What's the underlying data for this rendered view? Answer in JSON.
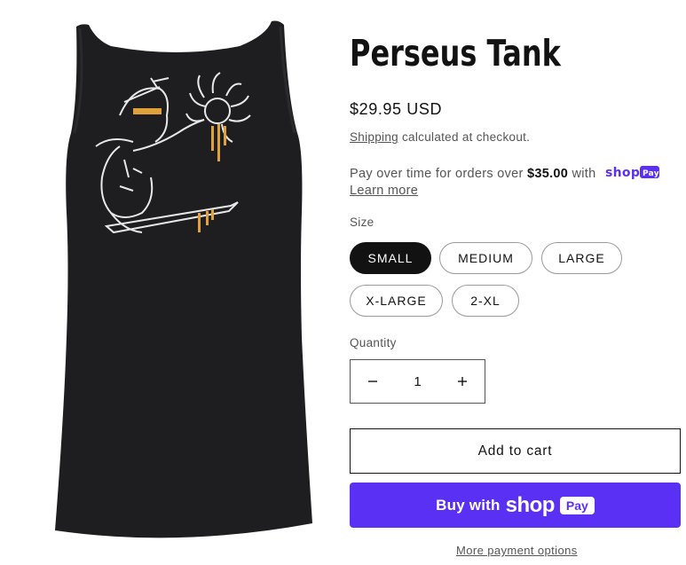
{
  "product": {
    "title": "Perseus Tank",
    "price": "$29.95 USD",
    "shipping_link": "Shipping",
    "shipping_text": " calculated at checkout.",
    "installments": {
      "prefix": "Pay over time for orders over ",
      "amount": "$35.00",
      "suffix": " with",
      "learn_more": "Learn more"
    },
    "image_description_icon": "tank-top-image"
  },
  "size": {
    "label": "Size",
    "options": [
      "SMALL",
      "MEDIUM",
      "LARGE",
      "X-LARGE",
      "2-XL"
    ],
    "selected": "SMALL"
  },
  "quantity": {
    "label": "Quantity",
    "value": "1",
    "minus_icon": "minus-icon",
    "plus_icon": "plus-icon"
  },
  "actions": {
    "add_to_cart": "Add to cart",
    "buy_with": "Buy with",
    "shop_word": "shop",
    "pay_badge": "Pay",
    "more_payment": "More payment options"
  },
  "colors": {
    "shop_purple": "#5a31f4",
    "text": "#121212",
    "muted": "#555555",
    "tank": "#1e1e20",
    "accent": "#e0a13a"
  }
}
